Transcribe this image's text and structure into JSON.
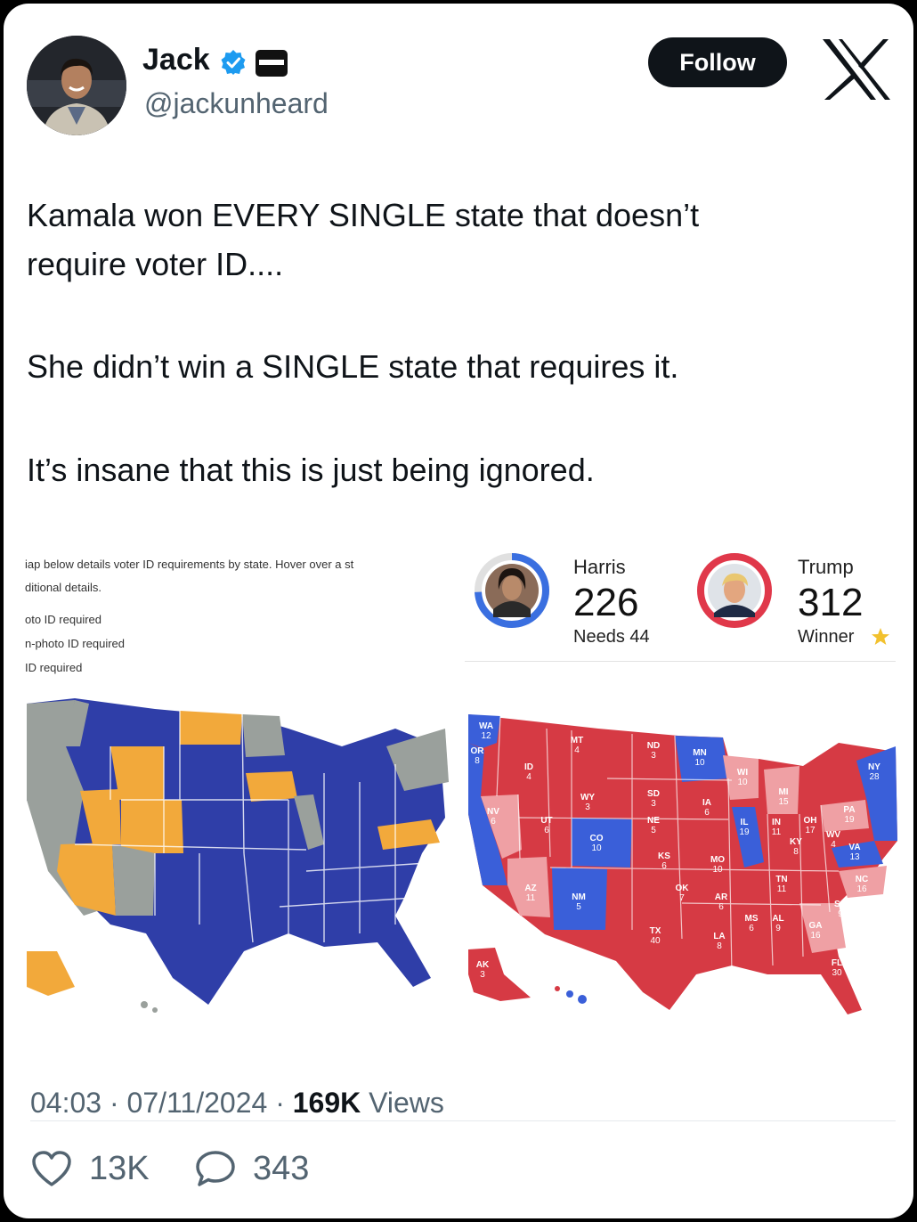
{
  "author": {
    "name": "Jack",
    "handle": "@jackunheard"
  },
  "follow_label": "Follow",
  "tweet": {
    "paragraphs": [
      "Kamala won EVERY SINGLE state that doesn’t\nrequire voter ID....",
      "She didn’t win a SINGLE state that requires it.",
      "It’s insane that this is just being ignored."
    ]
  },
  "media": {
    "left_panel": {
      "caption_lines": [
        "iap below details voter ID requirements by state. Hover over a st",
        "ditional details."
      ],
      "legend": [
        {
          "label": "oto ID required",
          "color": "#2e3fa8"
        },
        {
          "label": "n-photo ID required",
          "color": "#f2a93b"
        },
        {
          "label": "ID required",
          "color": "#9aa09c"
        }
      ]
    },
    "right_panel": {
      "candidates": [
        {
          "name": "Harris",
          "votes": "226",
          "status": "Needs 44",
          "color": "#3a6fe0"
        },
        {
          "name": "Trump",
          "votes": "312",
          "status": "Winner",
          "color": "#e0384a"
        }
      ],
      "state_labels": [
        "WA 12",
        "OR 8",
        "ID 4",
        "MT 4",
        "ND 3",
        "MN 10",
        "WI 10",
        "MI 15",
        "NY 28",
        "NV 6",
        "UT 6",
        "WY 3",
        "SD 3",
        "NE 5",
        "IA 6",
        "IL 19",
        "IN 11",
        "OH 17",
        "PA 19",
        "CO 10",
        "KS 6",
        "MO 10",
        "KY 8",
        "WV 4",
        "VA 13",
        "AZ 11",
        "NM 5",
        "OK 7",
        "AR 6",
        "TN 11",
        "NC 16",
        "SC 9",
        "TX 40",
        "LA 8",
        "MS 6",
        "AL 9",
        "GA 16",
        "FL 30",
        "AK 3"
      ]
    }
  },
  "meta": {
    "time": "04:03",
    "date": "07/11/2024",
    "views_count": "169K",
    "views_label": "Views"
  },
  "actions": {
    "likes": "13K",
    "replies": "343"
  },
  "colors": {
    "text_primary": "#0f1419",
    "text_secondary": "#536471",
    "verified": "#1d9bf0",
    "dem_blue": "#3a5fd9",
    "gop_red": "#d63a44"
  }
}
